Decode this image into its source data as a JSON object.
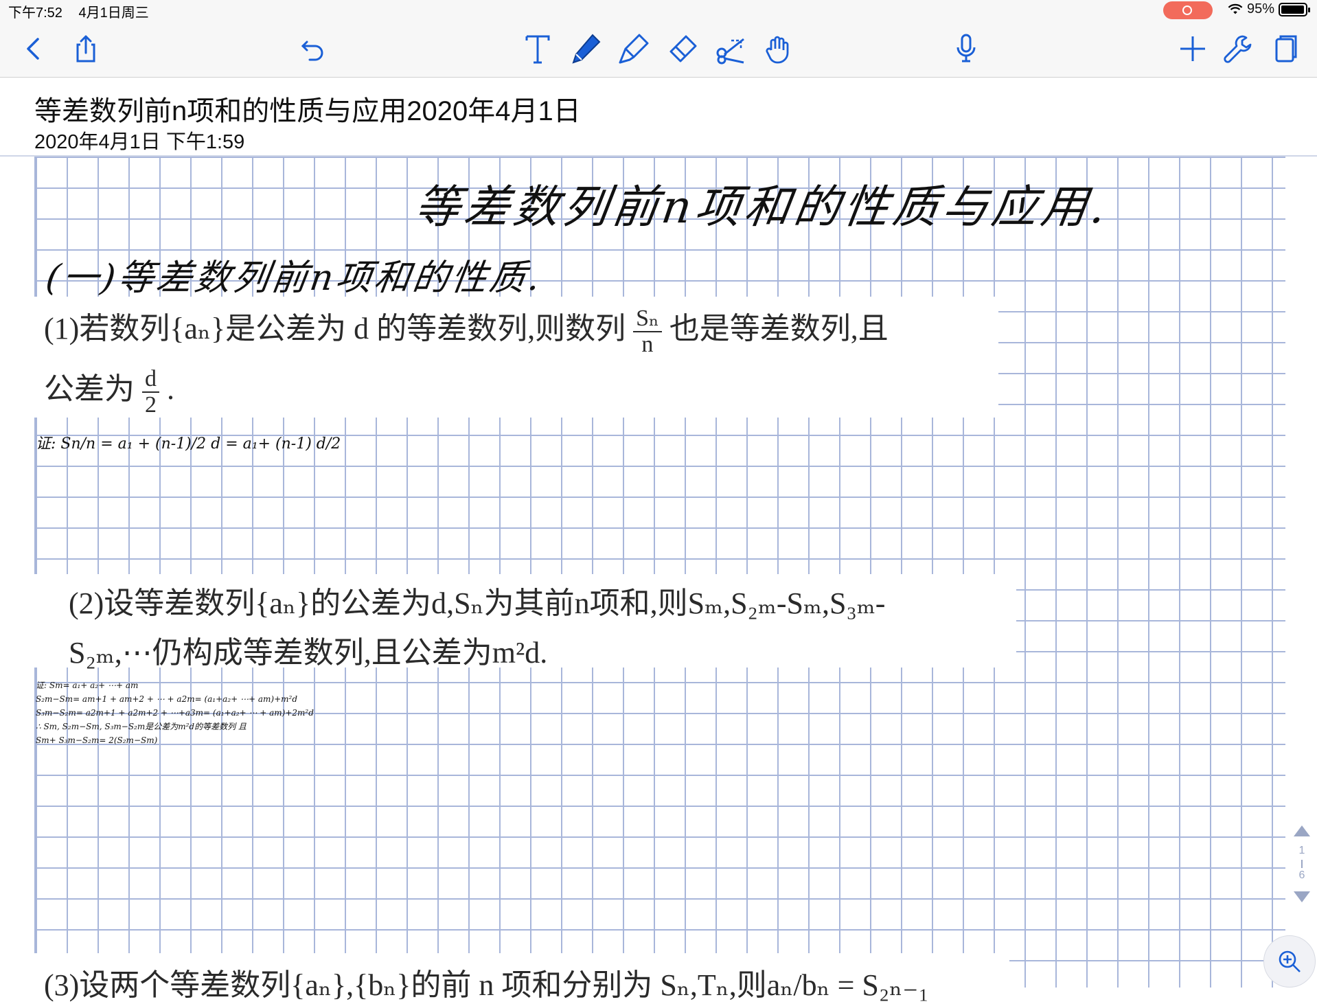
{
  "status_bar": {
    "time": "下午7:52",
    "date": "4月1日周三",
    "battery": "95%"
  },
  "toolbar": {
    "back": "back-icon",
    "share": "share-icon",
    "undo": "undo-icon",
    "tools": [
      "text-tool-icon",
      "pen-tool-icon",
      "highlighter-tool-icon",
      "eraser-tool-icon",
      "lasso-tool-icon",
      "hand-tool-icon"
    ],
    "mic": "microphone-icon",
    "right": [
      "add-icon",
      "wrench-icon",
      "pages-icon"
    ],
    "accent": "#1a5fd6"
  },
  "document": {
    "title": "等差数列前n项和的性质与应用2020年4月1日",
    "created": "2020年4月1日 下午1:59"
  },
  "content": {
    "handwritten_title": "等差数列前n项和的性质与应用.",
    "handwritten_subtitle": "(一)等差数列前n项和的性质.",
    "prop1_line1_a": "(1)若数列{aₙ}是公差为 d 的等差数列,则数列",
    "prop1_frac_num": "Sₙ",
    "prop1_frac_den": "n",
    "prop1_line1_b": "也是等差数列,且",
    "prop1_line2": "公差为",
    "prop1_frac2_num": "d",
    "prop1_frac2_den": "2",
    "prop1_line2_end": ".",
    "proof1": "证: Sn/n = a₁ + (n-1)/2 d = a₁+ (n-1) d/2",
    "prop2_line1": "(2)设等差数列{aₙ}的公差为d,Sₙ为其前n项和,则Sₘ,S₂ₘ-Sₘ,S₃ₘ-",
    "prop2_line2": "S₂ₘ,⋯仍构成等差数列,且公差为m²d.",
    "proof2": [
      "证: Sm= a₁+ a₂+ ⋯+ am",
      "S₂m−Sm= am+1 + am+2 + ⋯ + a2m= (a₁+a₂+ ⋯+ am)+m²d",
      "S₃m−S₂m= a2m+1 + a2m+2 + ⋯+a3m= (a₁+a₂+ ⋯ + am)+2m²d",
      "∴ Sm, S₂m−Sm, S₃m−S₂m是公差为m²d的等差数列 且",
      "Sm+ S₃m−S₂m= 2(S₂m−Sm)"
    ],
    "prop3_line1": "(3)设两个等差数列{aₙ},{bₙ}的前 n 项和分别为 Sₙ,Tₙ,则aₙ/bₙ = S₂ₙ₋₁"
  },
  "pager": {
    "current": "1",
    "total": "6"
  }
}
